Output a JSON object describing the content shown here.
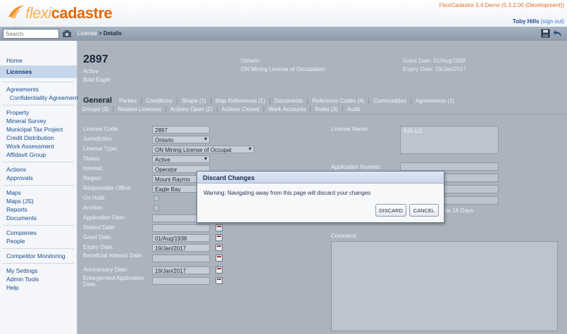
{
  "app": {
    "logo_part1": "flexi",
    "logo_part2": "cadastre",
    "version": "FlexiCadastre 5.4 Demo (5.3.2.00 (Development))",
    "user_name": "Toby Hills",
    "sign_out": "(sign out)"
  },
  "search": {
    "placeholder": "Search"
  },
  "breadcrumb": {
    "parent": "License",
    "separator": ">",
    "current": "Details"
  },
  "sidebar": {
    "groups": [
      [
        "Home",
        "Licenses"
      ],
      [
        "Agreements",
        "Confidentiality Agreement"
      ],
      [
        "Property",
        "Mineral Survey",
        "Municipal Tax Project",
        "Credit Distribution",
        "Work Assessment",
        "Affidavit Group"
      ],
      [
        "Actions",
        "Approvals"
      ],
      [
        "Maps",
        "Maps (JS)",
        "Reports",
        "Documents"
      ],
      [
        "Companies",
        "People"
      ],
      [
        "Competitor Monitoring"
      ],
      [
        "My Settings",
        "Admin Tools",
        "Help"
      ]
    ],
    "active": "Licenses"
  },
  "summary": {
    "number": "2897",
    "status": "Active",
    "holder": "Bald Eagle",
    "jurisdiction": "Ontario",
    "type": "ON Mining License of Occupation",
    "grant_date": "Grant Date: 01/Aug/1938",
    "expiry_date": "Expiry Date: 19/Jan/2017"
  },
  "tabs": {
    "active": "General",
    "row1": [
      "Parties",
      "Conditions",
      "Shape (1)",
      "Map References (1)",
      "Documents",
      "Reference Codes (4)",
      "Commodities",
      "Agreements (1)"
    ],
    "row2": [
      "Groups (3)",
      "Related Licenses",
      "Actions Open (2)",
      "Actions Closed",
      "Work Accounts",
      "Roles (3)",
      "Audit"
    ]
  },
  "form": {
    "license_code_label": "License Code:",
    "license_code": "2897",
    "jurisdiction_label": "Jurisdiction:",
    "jurisdiction": "Ontario",
    "license_type_label": "License Type:",
    "license_type": "ON Mining License of Occupat",
    "status_label": "Status:",
    "status": "Active",
    "interest_label": "Interest:",
    "interest": "Operator",
    "region_label": "Region:",
    "region": "Mount Raymo",
    "office_label": "Responsible Office:",
    "office": "Eagle Bay",
    "on_hold_label": "On Hold:",
    "archive_label": "Archive:",
    "application_date_label": "Application Date:",
    "staked_date_label": "Staked Date:",
    "grant_date_label": "Grant Date:",
    "grant_date": "01/Aug/1938",
    "expiry_date_label": "Expiry Date:",
    "expiry_date": "19/Jan/2017",
    "beneficial_label": "Beneficial Interest Date:",
    "anniversary_label": "Anniversary Date:",
    "anniversary_date": "19/Jan/2017",
    "enlargement_label": "Enlargement Application Date:",
    "license_name_label": "License Name:",
    "license_name": "915-LO",
    "application_number_label": "Application Number:",
    "days_text": "his 18 Days",
    "comment_label": "Comment:"
  },
  "modal": {
    "title": "Discard Changes",
    "message": "Warning: Navigating away from this page will discard your changes",
    "discard": "DISCARD",
    "cancel": "CANCEL"
  }
}
